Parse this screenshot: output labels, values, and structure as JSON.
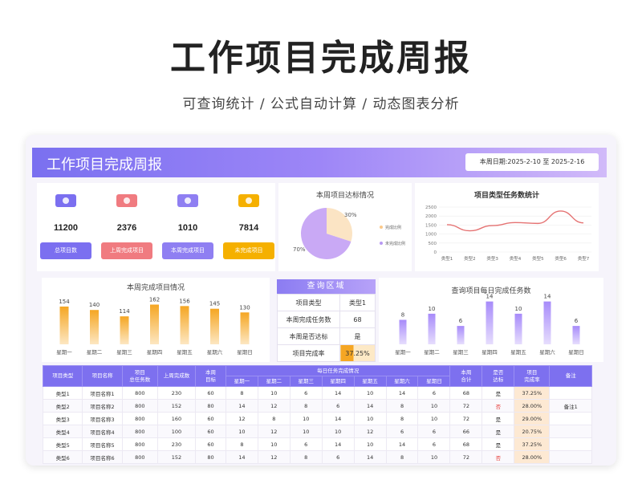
{
  "promo": {
    "title": "工作项目完成周报",
    "subtitle": "可查询统计 /  公式自动计算  /  动态图表分析"
  },
  "header": {
    "title": "工作项目完成周报",
    "date_range": "本周日期:2025-2-10  至  2025-2-16"
  },
  "stats": [
    {
      "icon": "wallet-icon",
      "value": "11200",
      "label": "总项目数",
      "color": "#7b6ff0"
    },
    {
      "icon": "calendar-icon",
      "value": "2376",
      "label": "上周完成项目",
      "color": "#f07b80"
    },
    {
      "icon": "crown-icon",
      "value": "1010",
      "label": "本周完成项目",
      "color": "#8f7ff2"
    },
    {
      "icon": "briefcase-icon",
      "value": "7814",
      "label": "未完成项目",
      "color": "#f5b000"
    }
  ],
  "pie": {
    "title": "本周项目达标情况",
    "label_done": "30%",
    "label_undone": "70%",
    "legend": [
      "完成比例",
      "未完成比例"
    ],
    "colors": [
      "#fbe4c4",
      "#c9a9f5"
    ]
  },
  "weekly_completion": {
    "title": "本周完成项目情况"
  },
  "type_stats": {
    "title": "项目类型任务数统计"
  },
  "daily_query": {
    "title": "查询项目每日完成任务数"
  },
  "query": {
    "title": "查询区域",
    "rows": [
      {
        "label": "项目类型",
        "value": "类型1"
      },
      {
        "label": "本周完成任务数",
        "value": "68"
      },
      {
        "label": "本周是否达标",
        "value": "是"
      },
      {
        "label": "项目完成率",
        "value": "37.25%"
      }
    ],
    "completion_rate": 0.3725
  },
  "chart_data": [
    {
      "type": "pie",
      "title": "本周项目达标情况",
      "labels": [
        "完成比例",
        "未完成比例"
      ],
      "values": [
        30,
        70
      ]
    },
    {
      "type": "bar",
      "title": "本周完成项目情况",
      "categories": [
        "星期一",
        "星期二",
        "星期三",
        "星期四",
        "星期五",
        "星期六",
        "星期日"
      ],
      "values": [
        154,
        140,
        114,
        162,
        156,
        145,
        130
      ],
      "ylim": [
        0,
        180
      ],
      "color": "#f5a623"
    },
    {
      "type": "line",
      "title": "项目类型任务数统计",
      "categories": [
        "类型1",
        "类型2",
        "类型3",
        "类型4",
        "类型5",
        "类型6",
        "类型7"
      ],
      "values": [
        1520,
        1180,
        1470,
        1640,
        1590,
        2280,
        1620
      ],
      "yticks": [
        0,
        500,
        1000,
        1500,
        2000,
        2500
      ],
      "ylim": [
        0,
        2500
      ],
      "color": "#e57373"
    },
    {
      "type": "bar",
      "title": "查询项目每日完成任务数",
      "categories": [
        "星期一",
        "星期二",
        "星期三",
        "星期四",
        "星期五",
        "星期六",
        "星期日"
      ],
      "values": [
        8,
        10,
        6,
        14,
        10,
        14,
        6
      ],
      "ylim": [
        0,
        16
      ],
      "color": "#a78bfa"
    }
  ],
  "table": {
    "headers": [
      "项目类型",
      "项目名称",
      "项目\n总任务数",
      "上周完成数",
      "本周\n目标",
      "每日任务完成情况",
      "本周\n合计",
      "是否\n达标",
      "项目\n完成率",
      "备注"
    ],
    "days": [
      "星期一",
      "星期二",
      "星期三",
      "星期四",
      "星期五",
      "星期六",
      "星期日"
    ],
    "rows": [
      [
        "类型1",
        "项目名称1",
        "800",
        "230",
        "60",
        "8",
        "10",
        "6",
        "14",
        "10",
        "14",
        "6",
        "68",
        "是",
        "37.25%",
        ""
      ],
      [
        "类型2",
        "项目名称2",
        "800",
        "152",
        "80",
        "14",
        "12",
        "8",
        "6",
        "14",
        "8",
        "10",
        "72",
        "否",
        "28.00%",
        "备注1"
      ],
      [
        "类型3",
        "项目名称3",
        "800",
        "160",
        "60",
        "12",
        "8",
        "10",
        "14",
        "10",
        "8",
        "10",
        "72",
        "是",
        "29.00%",
        ""
      ],
      [
        "类型4",
        "项目名称4",
        "800",
        "100",
        "60",
        "10",
        "12",
        "10",
        "10",
        "12",
        "6",
        "6",
        "66",
        "是",
        "20.75%",
        ""
      ],
      [
        "类型5",
        "项目名称5",
        "800",
        "230",
        "60",
        "8",
        "10",
        "6",
        "14",
        "10",
        "14",
        "6",
        "68",
        "是",
        "37.25%",
        ""
      ],
      [
        "类型6",
        "项目名称6",
        "800",
        "152",
        "80",
        "14",
        "12",
        "8",
        "6",
        "14",
        "8",
        "10",
        "72",
        "否",
        "28.00%",
        ""
      ]
    ]
  }
}
